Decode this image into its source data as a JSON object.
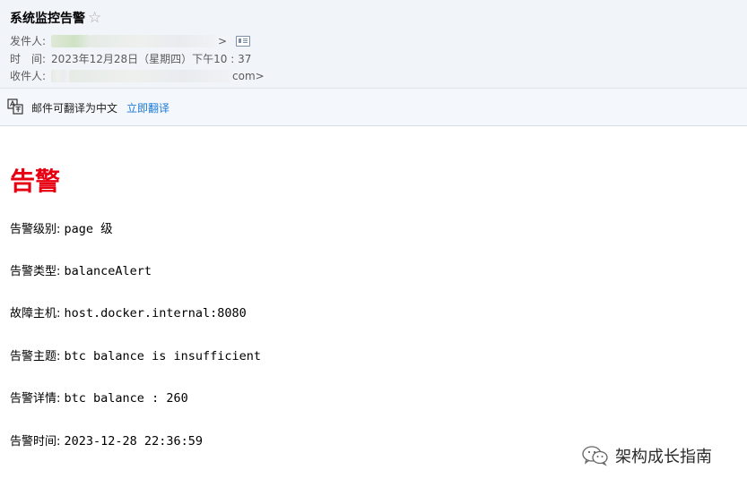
{
  "email": {
    "subject": "系统监控告警",
    "star_icon": "star-outline-icon",
    "from_label": "发件人:",
    "from_value_tail": ">",
    "time_label": "时　间:",
    "time_value": "2023年12月28日（星期四）下午10 : 37",
    "to_label": "收件人:",
    "to_value_tail": "com>"
  },
  "translate": {
    "notice": "邮件可翻译为中文",
    "action": "立即翻译"
  },
  "body": {
    "title": "告警",
    "rows": [
      {
        "label": "告警级别:",
        "value": "page 级"
      },
      {
        "label": "告警类型:",
        "value": "balanceAlert"
      },
      {
        "label": "故障主机:",
        "value": "host.docker.internal:8080"
      },
      {
        "label": "告警主题:",
        "value": "btc balance is insufficient"
      },
      {
        "label": "告警详情:",
        "value": "btc balance : 260"
      },
      {
        "label": "告警时间:",
        "value": "2023-12-28 22:36:59"
      }
    ]
  },
  "watermark": {
    "text": "架构成长指南",
    "icon": "wechat-icon"
  },
  "colors": {
    "title_red": "#e60012",
    "link_blue": "#1b7ad9",
    "header_bg": "#f1f5fa"
  }
}
